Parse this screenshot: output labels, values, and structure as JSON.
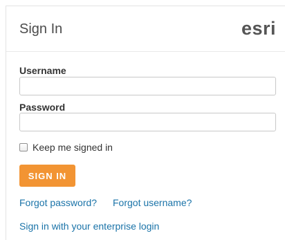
{
  "header": {
    "title": "Sign In",
    "logo_text": "esri"
  },
  "form": {
    "username_label": "Username",
    "username_value": "",
    "password_label": "Password",
    "password_value": "",
    "remember_label": "Keep me signed in",
    "remember_checked": false,
    "submit_label": "SIGN IN"
  },
  "links": {
    "forgot_password": "Forgot password?",
    "forgot_username": "Forgot username?",
    "enterprise_login": "Sign in with your enterprise login"
  },
  "colors": {
    "accent_button": "#f29433",
    "link": "#1a73a8"
  }
}
